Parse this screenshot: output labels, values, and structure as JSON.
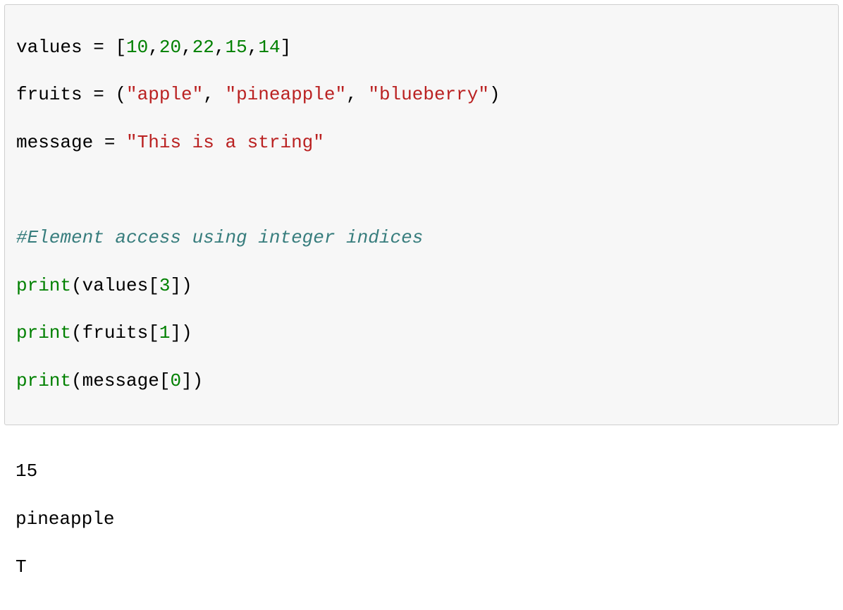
{
  "code": {
    "line1": {
      "var": "values",
      "eq": " = ",
      "lb": "[",
      "n1": "10",
      "c1": ",",
      "n2": "20",
      "c2": ",",
      "n3": "22",
      "c3": ",",
      "n4": "15",
      "c4": ",",
      "n5": "14",
      "rb": "]"
    },
    "line2": {
      "var": "fruits",
      "eq": " = ",
      "lp": "(",
      "s1": "\"apple\"",
      "c1": ", ",
      "s2": "\"pineapple\"",
      "c2": ", ",
      "s3": "\"blueberry\"",
      "rp": ")"
    },
    "line3": {
      "var": "message",
      "eq": " = ",
      "s1": "\"This is a string\""
    },
    "line5": {
      "comment": "#Element access using integer indices"
    },
    "line6": {
      "fn": "print",
      "lp": "(",
      "arg": "values",
      "lb": "[",
      "idx": "3",
      "rb": "]",
      "rp": ")"
    },
    "line7": {
      "fn": "print",
      "lp": "(",
      "arg": "fruits",
      "lb": "[",
      "idx": "1",
      "rb": "]",
      "rp": ")"
    },
    "line8": {
      "fn": "print",
      "lp": "(",
      "arg": "message",
      "lb": "[",
      "idx": "0",
      "rb": "]",
      "rp": ")"
    }
  },
  "output": {
    "line1": "15",
    "line2": "pineapple",
    "line3": "T"
  }
}
